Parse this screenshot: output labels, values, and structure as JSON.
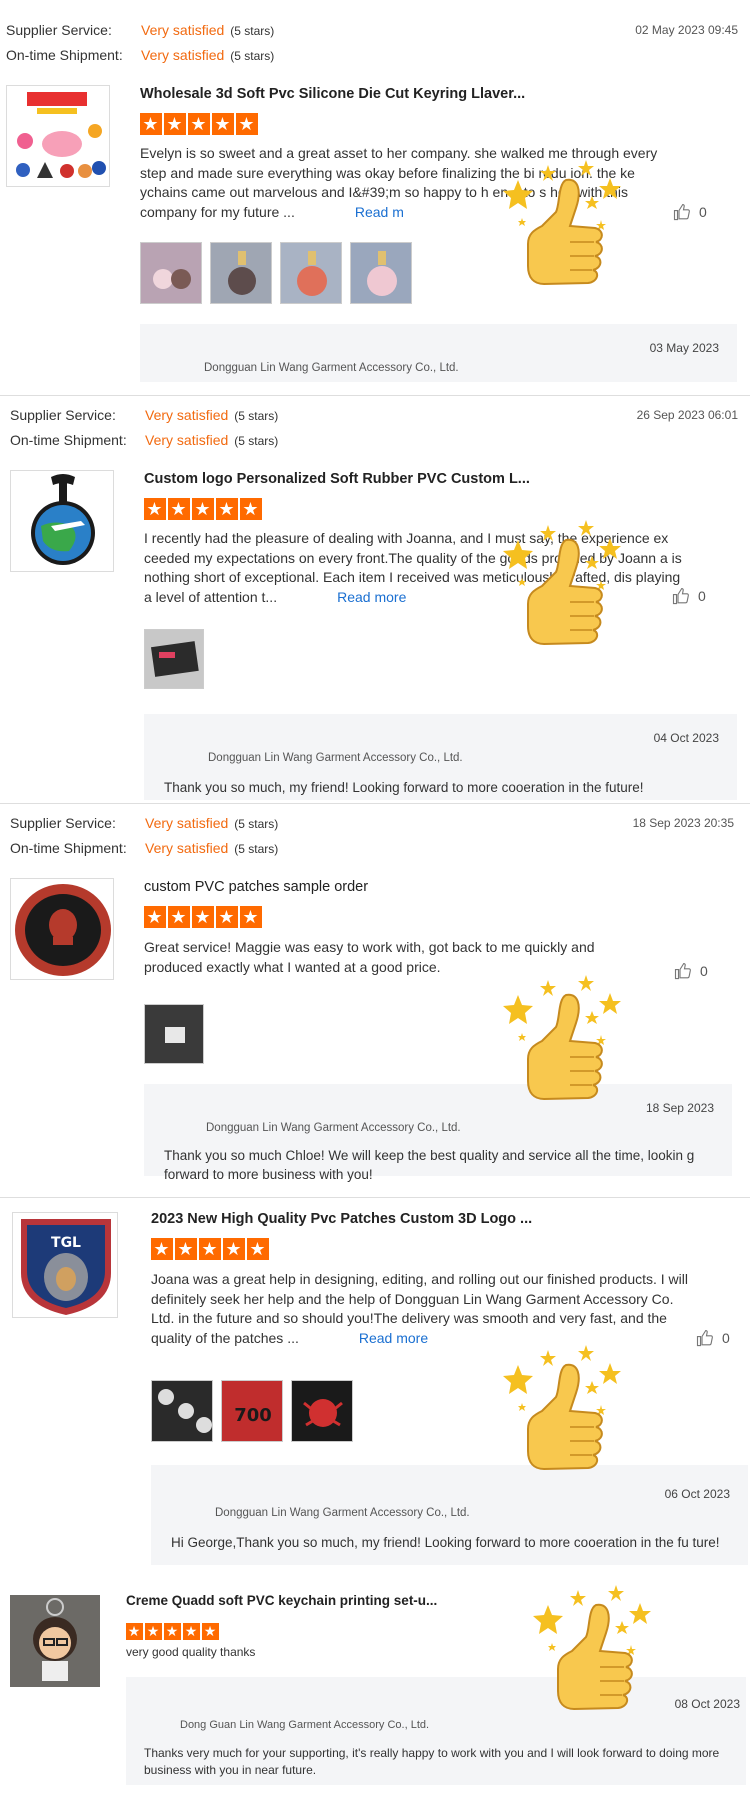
{
  "labels": {
    "supplier_service": "Supplier Service:",
    "ontime_shipment": "On-time Shipment:",
    "very_satisfied": "Very satisfied",
    "five_stars": "(5 stars)",
    "read_more": "Read more"
  },
  "reviews": [
    {
      "date": "02 May 2023 09:45",
      "title": "Wholesale 3d Soft Pvc Silicone Die Cut Keyring Llaver...",
      "body": "Evelyn is so sweet and a great asset to her company. she walked me through every step and made sure everything was okay before finalizing the bi  rodu  ion. the ke ychains came out marvelous and I&#39;m so happy to h  en      e to s hop with this company for my future ...",
      "read_more": "Read m",
      "likes": "0",
      "reply_date": "03 May 2023",
      "reply_company": "Dongguan Lin Wang Garment Accessory Co., Ltd.",
      "reply_text": ""
    },
    {
      "date": "26 Sep 2023 06:01",
      "title": "Custom logo Personalized Soft Rubber PVC Custom L...",
      "body": "I recently had the pleasure of dealing with Joanna, and I must say, the experience ex ceeded my expectations on every front.The quality of the goods provided by Joann a is nothing short of exceptional. Each item I received was meticulously crafted, dis playing a level of attention t...",
      "read_more": "Read more",
      "likes": "0",
      "reply_date": "04 Oct 2023",
      "reply_company": "Dongguan Lin Wang Garment Accessory Co., Ltd.",
      "reply_text": "Thank you so much, my friend! Looking forward to more cooeration in the future!"
    },
    {
      "date": "18 Sep 2023 20:35",
      "title": "custom PVC patches sample order",
      "body": "Great service! Maggie was easy to work with, got back to me quickly and produced exactly what I wanted at a good price.",
      "likes": "0",
      "reply_date": "18 Sep 2023",
      "reply_company": "Dongguan Lin Wang Garment Accessory Co., Ltd.",
      "reply_text": "Thank you so much Chloe! We will keep the best quality and service all the time, lookin g forward to more business with you!"
    },
    {
      "title": "2023 New High Quality Pvc Patches Custom 3D Logo ...",
      "body": "Joana was a great help in designing, editing, and rolling out our finished products. I will definitely seek her help and the help of Dongguan Lin Wang Garment Accessory Co. Ltd. in the future and so should you!The delivery was smooth and very fast, and the quality of the patches ...",
      "read_more": "Read more",
      "likes": "0",
      "reply_date": "06 Oct 2023",
      "reply_company": "Dongguan Lin Wang Garment Accessory Co., Ltd.",
      "reply_text": "Hi George,Thank you so much, my friend! Looking forward to more cooeration in the fu ture!"
    },
    {
      "title": "Creme Quadd soft PVC keychain printing set-u...",
      "body": "very good quality thanks",
      "reply_date": "08 Oct 2023",
      "reply_company": "Dong Guan Lin Wang Garment Accessory Co., Ltd.",
      "reply_text": "Thanks very much for your supporting, it's really happy to work with you and I will look forward to doing more business with you in near future."
    }
  ],
  "colors": {
    "accent": "#ff6a00",
    "link": "#1a6fd1",
    "reply_bg": "#f4f5f7"
  }
}
